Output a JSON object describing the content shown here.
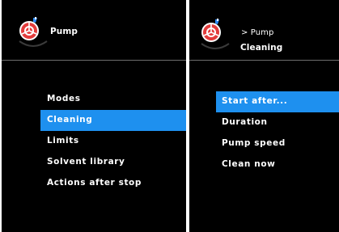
{
  "colors": {
    "background": "#000000",
    "selection": "#1e90ef",
    "text": "#ffffff",
    "logo_red": "#e23b3b"
  },
  "left_panel": {
    "title": "Pump",
    "icon": "pump-icon",
    "menu": [
      {
        "label": "Modes",
        "selected": false
      },
      {
        "label": "Cleaning",
        "selected": true
      },
      {
        "label": "Limits",
        "selected": false
      },
      {
        "label": "Solvent library",
        "selected": false
      },
      {
        "label": "Actions after stop",
        "selected": false
      }
    ]
  },
  "right_panel": {
    "breadcrumb": "> Pump",
    "title": "Cleaning",
    "icon": "pump-icon",
    "menu": [
      {
        "label": "Start after...",
        "selected": true
      },
      {
        "label": "Duration",
        "selected": false
      },
      {
        "label": "Pump speed",
        "selected": false
      },
      {
        "label": "Clean now",
        "selected": false
      }
    ]
  }
}
